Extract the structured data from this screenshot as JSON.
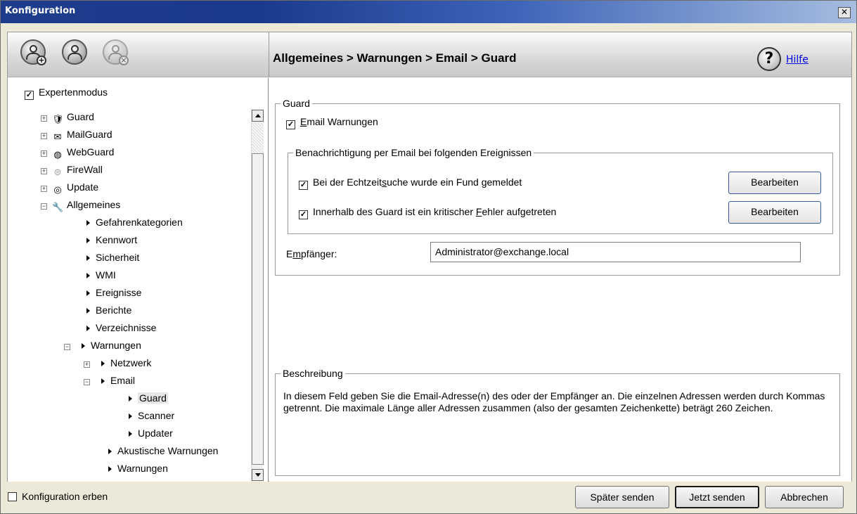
{
  "window": {
    "title": "Konfiguration",
    "close_glyph": "✕"
  },
  "toolbar": {
    "icons": [
      "add-user-icon",
      "user-icon",
      "remove-user-icon"
    ],
    "path": "Allgemeines > Warnungen > Email > Guard",
    "help_label": "Hilfe"
  },
  "tree": {
    "expert_mode": {
      "label": "Expertenmodus",
      "checked": true
    },
    "items": [
      {
        "label": "Guard",
        "icon": "shield-icon"
      },
      {
        "label": "MailGuard",
        "icon": "mail-icon"
      },
      {
        "label": "WebGuard",
        "icon": "globe-icon"
      },
      {
        "label": "FireWall",
        "icon": "firewall-icon"
      },
      {
        "label": "Update",
        "icon": "update-icon"
      },
      {
        "label": "Allgemeines",
        "icon": "wrench-icon"
      },
      {
        "label": "Gefahrenkategorien"
      },
      {
        "label": "Kennwort"
      },
      {
        "label": "Sicherheit"
      },
      {
        "label": "WMI"
      },
      {
        "label": "Ereignisse"
      },
      {
        "label": "Berichte"
      },
      {
        "label": "Verzeichnisse"
      },
      {
        "label": "Warnungen"
      },
      {
        "label": "Netzwerk"
      },
      {
        "label": "Email"
      },
      {
        "label": "Guard",
        "selected": true
      },
      {
        "label": "Scanner"
      },
      {
        "label": "Updater"
      },
      {
        "label": "Akustische Warnungen"
      },
      {
        "label": "Warnungen"
      }
    ]
  },
  "guard_group": {
    "legend": "Guard",
    "email_warnings": {
      "pre": "",
      "u": "E",
      "post": "mail Warnungen",
      "checked": true
    },
    "notify_group": {
      "legend": "Benachrichtigung per Email bei folgenden Ereignissen",
      "events": [
        {
          "pre": "Bei der Echtzeit",
          "u": "s",
          "post": "uche wurde ein Fund gemeldet",
          "checked": true,
          "button": "Bearbeiten"
        },
        {
          "pre": "Innerhalb des Guard ist ein kritischer ",
          "u": "F",
          "post": "ehler aufgetreten",
          "checked": true,
          "button": "Bearbeiten"
        }
      ]
    },
    "recipient": {
      "pre": "E",
      "u": "m",
      "post": "pfänger:",
      "value": "Administrator@exchange.local"
    }
  },
  "description": {
    "legend": "Beschreibung",
    "text": "In diesem Feld geben Sie die Email-Adresse(n) des oder der Empfänger an. Die einzelnen Adressen werden durch Kommas getrennt. Die maximale Länge aller Adressen zusammen (also der gesamten Zeichenkette) beträgt 260 Zeichen."
  },
  "footer": {
    "inherit": {
      "label": "Konfiguration erben",
      "checked": false
    },
    "buttons": {
      "later": "Später senden",
      "now": "Jetzt senden",
      "cancel": "Abbrechen"
    }
  }
}
